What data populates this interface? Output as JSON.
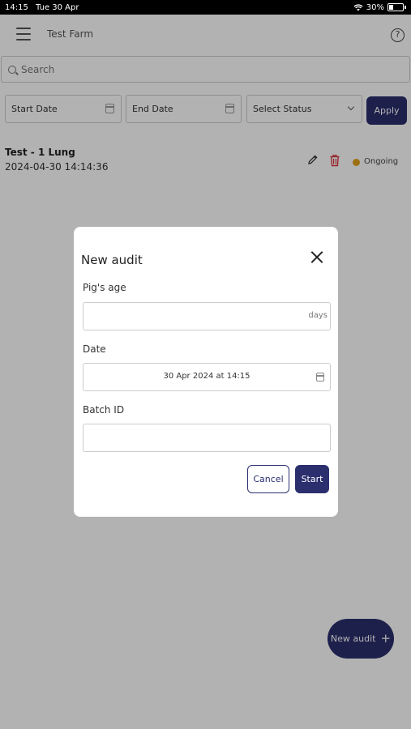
{
  "status_bar": {
    "time": "14:15",
    "date": "Tue 30 Apr",
    "battery": "30%",
    "battery_level": 0.3
  },
  "header": {
    "farm_name": "Test Farm",
    "menu_icon": "hamburger-icon",
    "help_icon": "help-circle-icon"
  },
  "search": {
    "placeholder": "Search"
  },
  "filters": {
    "start_date": "Start Date",
    "end_date": "End Date",
    "status": "Select Status",
    "apply_label": "Apply"
  },
  "audits": [
    {
      "name": "Test - 1 Lung",
      "timestamp": "2024-04-30 14:14:36",
      "status": "Ongoing",
      "status_color": "#e0a11b"
    }
  ],
  "fab": {
    "label": "New audit",
    "icon": "plus-icon"
  },
  "modal": {
    "title": "New audit",
    "pig_age_label": "Pig's age",
    "pig_age_value": "",
    "pig_age_suffix": "days",
    "date_label": "Date",
    "date_value": "30 Apr 2024 at 14:15",
    "batch_label": "Batch ID",
    "batch_value": "",
    "cancel_label": "Cancel",
    "start_label": "Start"
  },
  "colors": {
    "primary": "#2b2f6e",
    "delete": "#d9363e",
    "ongoing": "#e0a11b"
  }
}
